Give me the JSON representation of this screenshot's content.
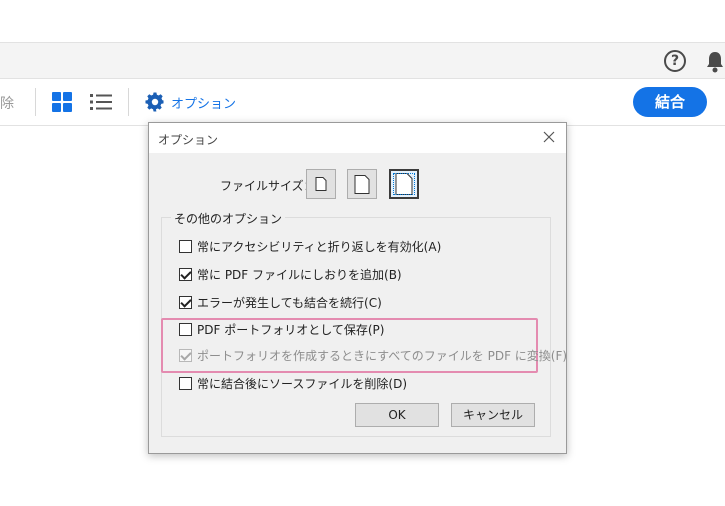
{
  "help_bar": {
    "help_icon": "question-circle-icon",
    "bell_icon": "bell-icon"
  },
  "toolbar": {
    "delete_label": "除",
    "grid_icon": "grid-view-icon",
    "list_icon": "list-view-icon",
    "options_label": "オプション",
    "combine_label": "結合",
    "accent_color": "#1473e6"
  },
  "dialog": {
    "title": "オプション",
    "file_size_label": "ファイルサイズ：",
    "file_size_options": [
      "small",
      "medium",
      "large"
    ],
    "file_size_selected": "large",
    "group_label": "その他のオプション",
    "checkboxes": [
      {
        "label": "常にアクセシビリティと折り返しを有効化(A)",
        "checked": false,
        "disabled": false
      },
      {
        "label": "常に PDF ファイルにしおりを追加(B)",
        "checked": true,
        "disabled": false
      },
      {
        "label": "エラーが発生しても結合を続行(C)",
        "checked": true,
        "disabled": false
      },
      {
        "label": "PDF ポートフォリオとして保存(P)",
        "checked": false,
        "disabled": false
      },
      {
        "label": "ポートフォリオを作成するときにすべてのファイルを PDF に変換(F)",
        "checked": true,
        "disabled": true
      },
      {
        "label": "常に結合後にソースファイルを削除(D)",
        "checked": false,
        "disabled": false
      }
    ],
    "ok_label": "OK",
    "cancel_label": "キャンセル",
    "highlight_color": "#e48bb0"
  }
}
